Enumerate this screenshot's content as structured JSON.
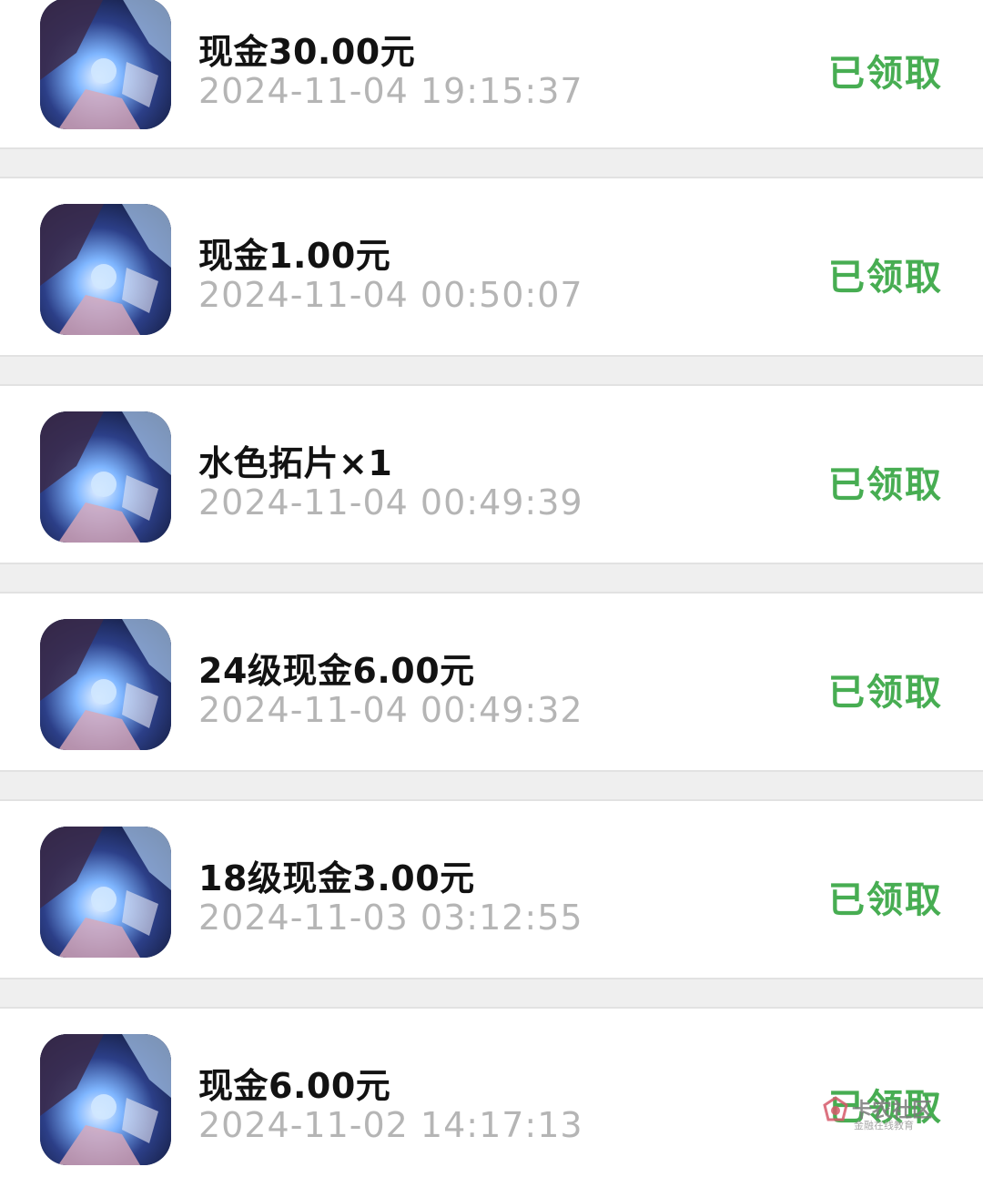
{
  "records": [
    {
      "title": "现金30.00元",
      "time": "2024-11-04 19:15:37",
      "status": "已领取",
      "icon": "game-avatar-icon"
    },
    {
      "title": "现金1.00元",
      "time": "2024-11-04 00:50:07",
      "status": "已领取",
      "icon": "game-avatar-icon"
    },
    {
      "title": "水色拓片×1",
      "time": "2024-11-04 00:49:39",
      "status": "已领取",
      "icon": "game-avatar-icon"
    },
    {
      "title": "24级现金6.00元",
      "time": "2024-11-04 00:49:32",
      "status": "已领取",
      "icon": "game-avatar-icon"
    },
    {
      "title": "18级现金3.00元",
      "time": "2024-11-03 03:12:55",
      "status": "已领取",
      "icon": "game-avatar-icon"
    },
    {
      "title": "现金6.00元",
      "time": "2024-11-02 14:17:13",
      "status": "已领取",
      "icon": "game-avatar-icon"
    }
  ],
  "watermark": {
    "brand": "卡农社区",
    "slogan": "金融在线教育"
  },
  "colors": {
    "background": "#efefef",
    "card": "#ffffff",
    "title": "#121212",
    "time": "#b5b5b5",
    "status": "#47ad52"
  }
}
